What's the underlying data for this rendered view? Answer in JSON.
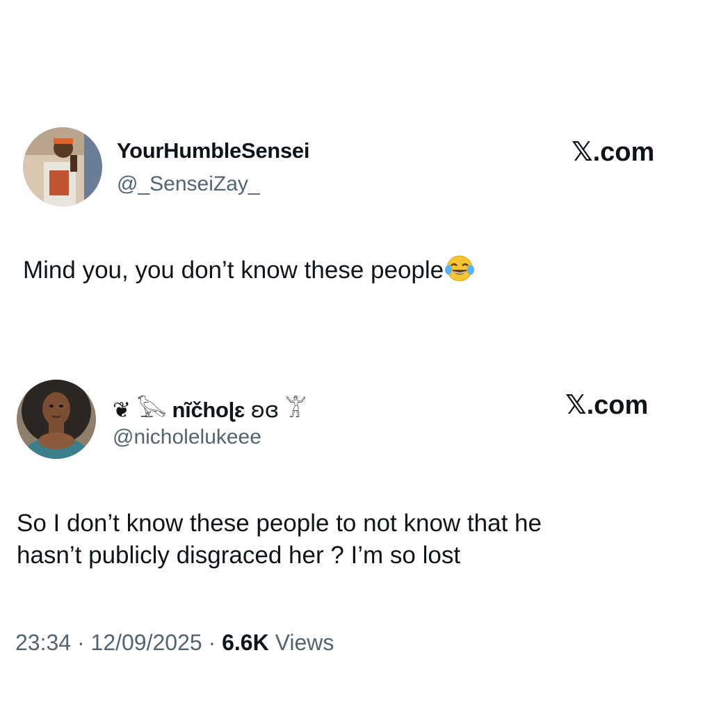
{
  "tweet1": {
    "display_name": "YourHumbleSensei",
    "handle": "@_SenseiZay_",
    "brand": "𝕏.com",
    "text": "Mind you, you don’t know these people",
    "emoji": "face-with-tears-of-joy-icon"
  },
  "tweet2": {
    "display_name_prefix": "❦ 𓅂",
    "display_name": "nĩčhoɭɛ",
    "display_name_suffix": "ʚɞ  𓀠",
    "handle": "@nicholelukeee",
    "brand": "𝕏.com",
    "text_line1": "So I don’t know these people to not know that he",
    "text_line2": "hasn’t publicly disgraced her ? I’m so lost"
  },
  "meta": {
    "time": "23:34",
    "sep1": " · ",
    "date": "12/09/2025",
    "sep2": " · ",
    "views_count": "6.6K",
    "views_label": " Views"
  },
  "colors": {
    "text": "#0f1419",
    "secondary": "#536471",
    "background": "#ffffff"
  }
}
